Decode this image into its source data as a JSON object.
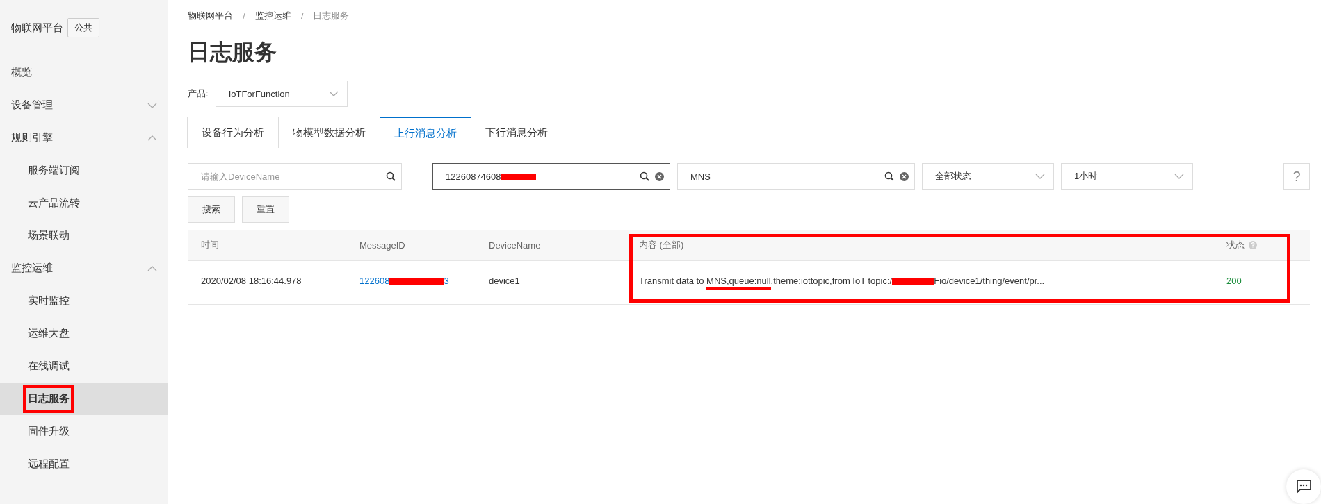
{
  "sidebar": {
    "title": "物联网平台",
    "badge": "公共",
    "items": [
      {
        "label": "概览",
        "selected": false
      },
      {
        "label": "设备管理",
        "expanded": false
      },
      {
        "label": "规则引擎",
        "expanded": true,
        "children": [
          {
            "label": "服务端订阅",
            "selected": false
          },
          {
            "label": "云产品流转",
            "selected": false
          },
          {
            "label": "场景联动",
            "selected": false
          }
        ]
      },
      {
        "label": "监控运维",
        "expanded": true,
        "children": [
          {
            "label": "实时监控",
            "selected": false
          },
          {
            "label": "运维大盘",
            "selected": false
          },
          {
            "label": "在线调试",
            "selected": false
          },
          {
            "label": "日志服务",
            "selected": true
          },
          {
            "label": "固件升级",
            "selected": false
          },
          {
            "label": "远程配置",
            "selected": false
          }
        ]
      }
    ]
  },
  "breadcrumb": [
    "物联网平台",
    "监控运维",
    "日志服务"
  ],
  "breadcrumb_separator": "/",
  "page_title": "日志服务",
  "product": {
    "label": "产品:",
    "value": "IoTForFunction"
  },
  "tabs": [
    {
      "label": "设备行为分析",
      "selected": false
    },
    {
      "label": "物模型数据分析",
      "selected": false
    },
    {
      "label": "上行消息分析",
      "selected": true
    },
    {
      "label": "下行消息分析",
      "selected": false
    }
  ],
  "filters": {
    "device_name": {
      "placeholder": "请输入DeviceName"
    },
    "message_id": {
      "value": "12260874608",
      "redacted": true
    },
    "content": {
      "value": "MNS"
    },
    "status": "全部状态",
    "time_range": "1小时",
    "help": "?"
  },
  "buttons": [
    "搜索",
    "重置"
  ],
  "table": {
    "columns": [
      "时间",
      "MessageID",
      "DeviceName",
      "内容 (全部)",
      "状态"
    ],
    "rows": [
      {
        "time": "2020/02/08 18:16:44.978",
        "message_id_start": "122608",
        "message_id_end": "3",
        "device": "device1",
        "content_start": "Transmit data to ",
        "content_underlined": "MNS,queue:null",
        "content_mid": ",theme:iottopic,from IoT topic:/",
        "content_end": "Fio/device1/thing/event/pr...",
        "status": "200"
      }
    ]
  }
}
